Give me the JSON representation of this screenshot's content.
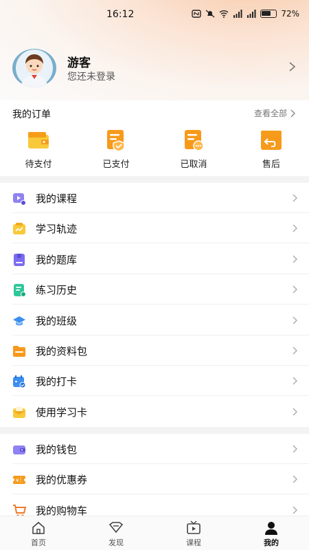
{
  "status_bar": {
    "time": "16:12",
    "battery": "72%"
  },
  "profile": {
    "nickname": "游客",
    "login_hint": "您还未登录"
  },
  "orders": {
    "title": "我的订单",
    "view_all": "查看全部",
    "items": [
      {
        "label": "待支付",
        "icon": "wallet-icon"
      },
      {
        "label": "已支付",
        "icon": "paid-receipt-icon"
      },
      {
        "label": "已取消",
        "icon": "cancelled-receipt-icon"
      },
      {
        "label": "售后",
        "icon": "return-box-icon"
      }
    ]
  },
  "menu_group_1": [
    {
      "label": "我的课程",
      "icon": "video-course-icon"
    },
    {
      "label": "学习轨迹",
      "icon": "trend-icon"
    },
    {
      "label": "我的题库",
      "icon": "question-bank-icon"
    },
    {
      "label": "练习历史",
      "icon": "practice-history-icon"
    },
    {
      "label": "我的班级",
      "icon": "graduation-cap-icon"
    },
    {
      "label": "我的资料包",
      "icon": "folder-icon"
    },
    {
      "label": "我的打卡",
      "icon": "calendar-check-icon"
    },
    {
      "label": "使用学习卡",
      "icon": "envelope-card-icon"
    }
  ],
  "menu_group_2": [
    {
      "label": "我的钱包",
      "icon": "wallet-purple-icon"
    },
    {
      "label": "我的优惠券",
      "icon": "coupon-icon"
    },
    {
      "label": "我的购物车",
      "icon": "cart-icon"
    }
  ],
  "tabbar": [
    {
      "label": "首页",
      "icon": "home-icon"
    },
    {
      "label": "发现",
      "icon": "discover-icon"
    },
    {
      "label": "课程",
      "icon": "course-tv-icon"
    },
    {
      "label": "我的",
      "icon": "person-icon",
      "active": true
    }
  ],
  "colors": {
    "accent_orange": "#f79a1c",
    "purple": "#7c6cf0",
    "yellow": "#f8c93a",
    "green": "#2fc79a",
    "blue": "#3d8ef0"
  }
}
